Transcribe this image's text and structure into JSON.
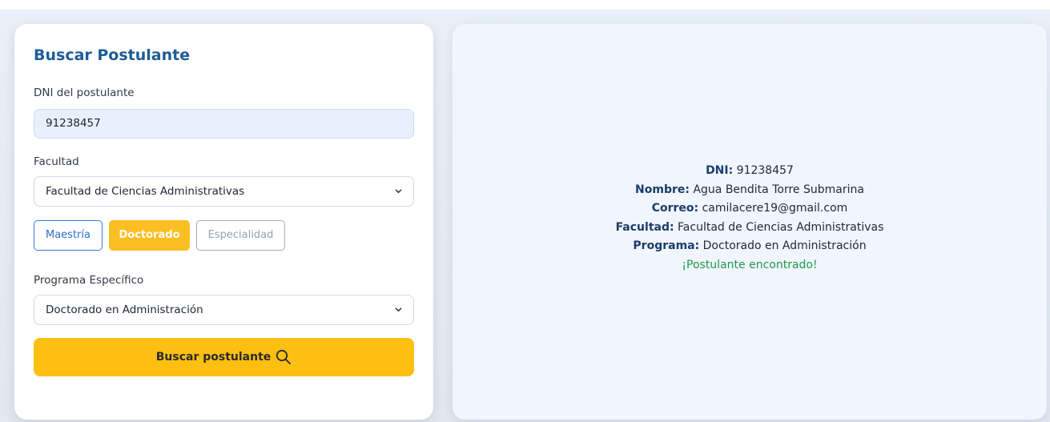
{
  "search_form": {
    "title": "Buscar Postulante",
    "dni_label": "DNI del postulante",
    "dni_value": "91238457",
    "faculty_label": "Facultad",
    "faculty_selected": "Facultad de Ciencias Administrativas",
    "program_types": [
      {
        "label": "Maestría",
        "state": "outline"
      },
      {
        "label": "Doctorado",
        "state": "active"
      },
      {
        "label": "Especialidad",
        "state": "inactive"
      }
    ],
    "specific_program_label": "Programa Específico",
    "specific_program_selected": "Doctorado en Administración",
    "search_button_label": "Buscar postulante",
    "search_button_icon": "search-icon"
  },
  "result": {
    "dni_key": "DNI:",
    "dni_value": "91238457",
    "name_key": "Nombre:",
    "name_value": "Agua Bendita Torre Submarina",
    "email_key": "Correo:",
    "email_value": "camilacere19@gmail.com",
    "faculty_key": "Facultad:",
    "faculty_value": "Facultad de Ciencias Administrativas",
    "program_key": "Programa:",
    "program_value": "Doctorado en Administración",
    "status_message": "¡Postulante encontrado!"
  },
  "colors": {
    "title": "#1d5c99",
    "accent_yellow": "#fcbf12",
    "success": "#1f9a4a",
    "outline_blue": "#3b7dd4"
  }
}
